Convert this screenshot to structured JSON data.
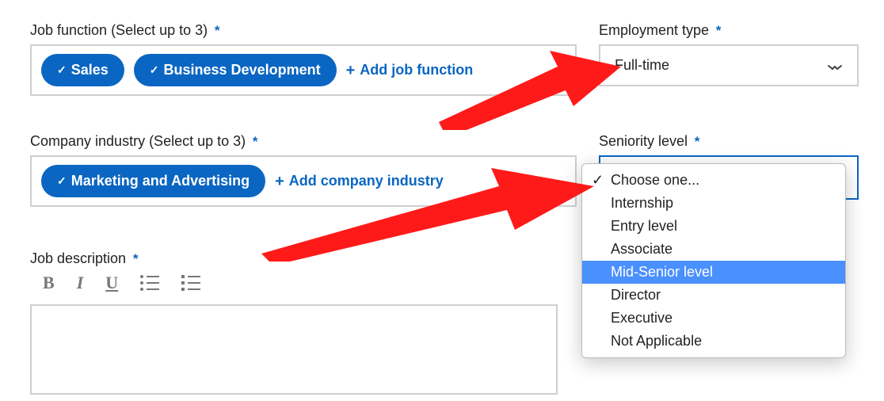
{
  "jobFunction": {
    "label": "Job function (Select up to 3)",
    "required": "*",
    "pills": [
      "Sales",
      "Business Development"
    ],
    "addLabel": "Add job function"
  },
  "employmentType": {
    "label": "Employment type",
    "required": "*",
    "value": "Full-time"
  },
  "industry": {
    "label": "Company industry (Select up to 3)",
    "required": "*",
    "pills": [
      "Marketing and Advertising"
    ],
    "addLabel": "Add company industry"
  },
  "seniority": {
    "label": "Seniority level",
    "required": "*",
    "options": [
      {
        "label": "Choose one...",
        "selected": true,
        "highlighted": false
      },
      {
        "label": "Internship",
        "selected": false,
        "highlighted": false
      },
      {
        "label": "Entry level",
        "selected": false,
        "highlighted": false
      },
      {
        "label": "Associate",
        "selected": false,
        "highlighted": false
      },
      {
        "label": "Mid-Senior level",
        "selected": false,
        "highlighted": true
      },
      {
        "label": "Director",
        "selected": false,
        "highlighted": false
      },
      {
        "label": "Executive",
        "selected": false,
        "highlighted": false
      },
      {
        "label": "Not Applicable",
        "selected": false,
        "highlighted": false
      }
    ]
  },
  "jobDescription": {
    "label": "Job description",
    "required": "*"
  },
  "toolbar": {
    "bold": "B",
    "italic": "I",
    "underline": "U"
  }
}
